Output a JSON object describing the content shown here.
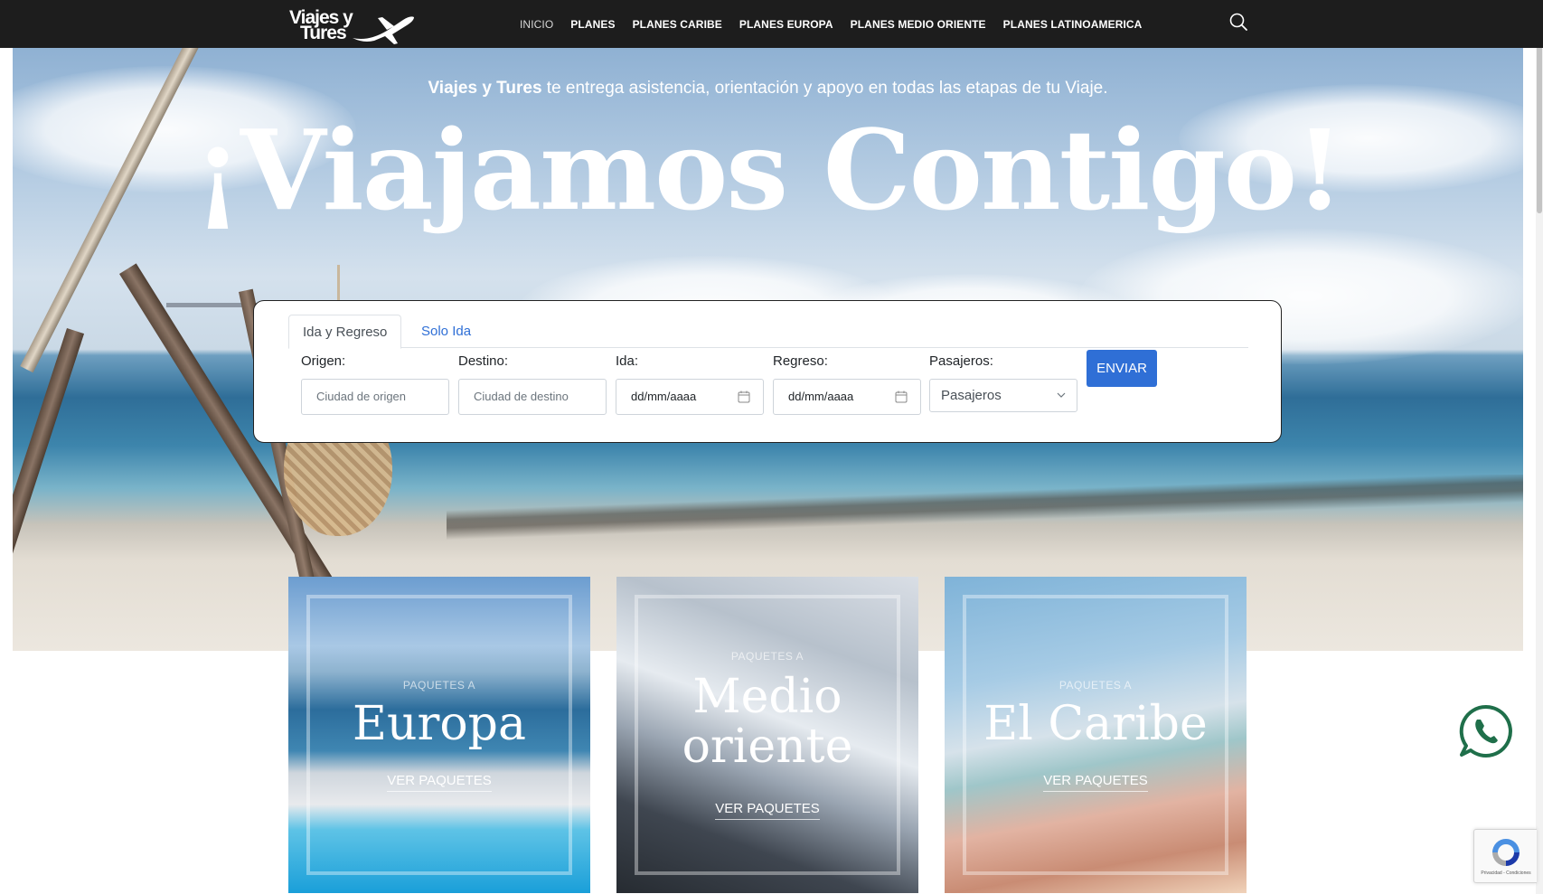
{
  "brand": {
    "logo_line1": "Viajes y",
    "logo_line2": "Tures"
  },
  "nav": {
    "items": [
      {
        "label": "INICIO",
        "active": true
      },
      {
        "label": "PLANES"
      },
      {
        "label": "PLANES CARIBE"
      },
      {
        "label": "PLANES EUROPA"
      },
      {
        "label": "PLANES MEDIO ORIENTE"
      },
      {
        "label": "PLANES LATINOAMERICA"
      }
    ],
    "search_icon": "search-icon"
  },
  "hero": {
    "tagline_brand": "Viajes y Tures",
    "tagline_rest": " te entrega asistencia, orientación y apoyo en todas las etapas de tu Viaje.",
    "title": "¡Viajamos Contigo!"
  },
  "search": {
    "tabs": [
      "Ida y Regreso",
      "Solo Ida"
    ],
    "active_tab": "Ida y Regreso",
    "fields": {
      "origen": {
        "label": "Origen:",
        "placeholder": "Ciudad de origen"
      },
      "destino": {
        "label": "Destino:",
        "placeholder": "Ciudad de destino"
      },
      "ida": {
        "label": "Ida:",
        "value": "dd/mm/aaaa"
      },
      "regreso": {
        "label": "Regreso:",
        "value": "dd/mm/aaaa"
      },
      "pasajeros": {
        "label": "Pasajeros:",
        "selected": "Pasajeros"
      }
    },
    "submit_label": "ENVIAR",
    "accent_color": "#2f6fd6"
  },
  "cards": [
    {
      "eyebrow": "PAQUETES A",
      "title": "Europa",
      "cta": "VER PAQUETES"
    },
    {
      "eyebrow": "PAQUETES A",
      "title": "Medio oriente",
      "cta": "VER PAQUETES"
    },
    {
      "eyebrow": "PAQUETES A",
      "title": "El Caribe",
      "cta": "VER PAQUETES"
    }
  ],
  "widgets": {
    "whatsapp_icon": "whatsapp-icon",
    "whatsapp_color": "#1f6f4a",
    "recaptcha_text": "Privacidad - Condiciones"
  }
}
